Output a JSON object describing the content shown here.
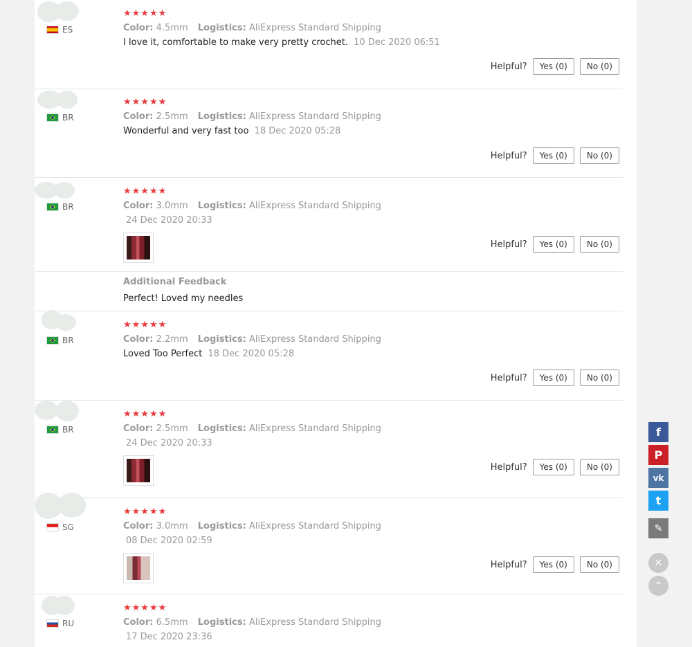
{
  "helpful_label": "Helpful?",
  "reviews": [
    {
      "country": "ES",
      "stars": "★★★★★",
      "color_label": "Color:",
      "color": "4.5mm",
      "logistics_label": "Logistics:",
      "logistics": "AliExpress Standard Shipping",
      "text": "I love it, comfortable to make very pretty crochet.",
      "date": "10 Dec 2020 06:51",
      "yes": "Yes (0)",
      "no": "No (0)"
    },
    {
      "country": "BR",
      "stars": "★★★★★",
      "color_label": "Color:",
      "color": "2.5mm",
      "logistics_label": "Logistics:",
      "logistics": "AliExpress Standard Shipping",
      "text": "Wonderful and very fast too",
      "date": "18 Dec 2020 05:28",
      "yes": "Yes (0)",
      "no": "No (0)"
    },
    {
      "country": "BR",
      "stars": "★★★★★",
      "color_label": "Color:",
      "color": "3.0mm",
      "logistics_label": "Logistics:",
      "logistics": "AliExpress Standard Shipping",
      "date": "24 Dec 2020 20:33",
      "yes": "Yes (0)",
      "no": "No (0)",
      "additional_label": "Additional Feedback",
      "additional_text": "Perfect! Loved my needles"
    },
    {
      "country": "BR",
      "stars": "★★★★★",
      "color_label": "Color:",
      "color": "2.2mm",
      "logistics_label": "Logistics:",
      "logistics": "AliExpress Standard Shipping",
      "text": "Loved Too Perfect",
      "date": "18 Dec 2020 05:28",
      "yes": "Yes (0)",
      "no": "No (0)"
    },
    {
      "country": "BR",
      "stars": "★★★★★",
      "color_label": "Color:",
      "color": "2.5mm",
      "logistics_label": "Logistics:",
      "logistics": "AliExpress Standard Shipping",
      "date": "24 Dec 2020 20:33",
      "yes": "Yes (0)",
      "no": "No (0)"
    },
    {
      "country": "SG",
      "stars": "★★★★★",
      "color_label": "Color:",
      "color": "3.0mm",
      "logistics_label": "Logistics:",
      "logistics": "AliExpress Standard Shipping",
      "date": "08 Dec 2020 02:59",
      "yes": "Yes (0)",
      "no": "No (0)"
    },
    {
      "country": "RU",
      "stars": "★★★★★",
      "color_label": "Color:",
      "color": "6.5mm",
      "logistics_label": "Logistics:",
      "logistics": "AliExpress Standard Shipping",
      "date": "17 Dec 2020 23:36"
    }
  ],
  "share": {
    "facebook": {
      "glyph": "f",
      "color": "#3b5998"
    },
    "pinterest": {
      "glyph": "P",
      "color": "#cb2027"
    },
    "vk": {
      "glyph": "vk",
      "color": "#4c75a3"
    },
    "twitter": {
      "glyph": "t",
      "color": "#1da1f2"
    },
    "edit": {
      "glyph": "✎",
      "color": "#7a7a7a"
    },
    "close": {
      "glyph": "✕"
    },
    "top": {
      "glyph": "⌃"
    }
  },
  "colors": {
    "star": "#e9393d",
    "muted": "#999999",
    "panel": "#ffffff",
    "page": "#f2f2f2"
  }
}
